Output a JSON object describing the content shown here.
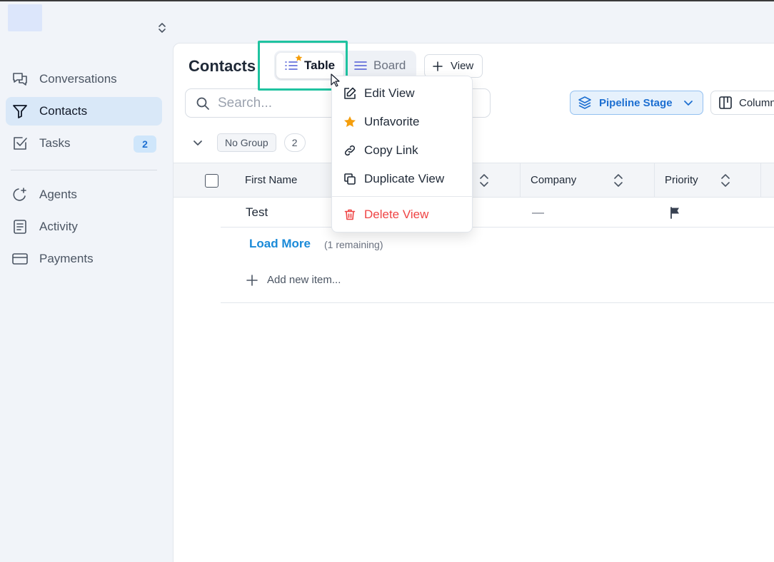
{
  "sidebar": {
    "items": [
      {
        "label": "Conversations",
        "icon": "chat-icon"
      },
      {
        "label": "Contacts",
        "icon": "filter-icon",
        "active": true
      },
      {
        "label": "Tasks",
        "icon": "checkbox-icon",
        "badge": "2"
      },
      {
        "label": "Agents",
        "icon": "agent-sparkle-icon"
      },
      {
        "label": "Activity",
        "icon": "document-icon"
      },
      {
        "label": "Payments",
        "icon": "credit-card-icon"
      }
    ]
  },
  "header": {
    "title": "Contacts",
    "tabs": [
      {
        "label": "Table",
        "active": true,
        "favorite": true
      },
      {
        "label": "Board",
        "active": false
      }
    ],
    "add_view_label": "View"
  },
  "toolbar": {
    "search_placeholder": "Search...",
    "pipeline_label": "Pipeline Stage",
    "columns_label": "Columns"
  },
  "group": {
    "label": "No Group",
    "count": "2"
  },
  "table": {
    "columns": [
      "First Name",
      "",
      "Company",
      "Priority"
    ],
    "rows": [
      {
        "first_name": "Test",
        "company": "—",
        "priority_icon": "flag-icon"
      }
    ],
    "load_more_label": "Load More",
    "remaining_label": "(1 remaining)",
    "add_item_label": "Add new item..."
  },
  "context_menu": {
    "items": [
      {
        "label": "Edit View",
        "icon": "edit-icon"
      },
      {
        "label": "Unfavorite",
        "icon": "star-icon"
      },
      {
        "label": "Copy Link",
        "icon": "link-icon"
      },
      {
        "label": "Duplicate View",
        "icon": "duplicate-icon"
      },
      {
        "label": "Delete View",
        "icon": "trash-icon",
        "danger": true
      }
    ]
  },
  "colors": {
    "accent": "#1d6fd1",
    "highlight": "#1fc3a0",
    "danger": "#ef4444",
    "star": "#f59e0b"
  }
}
